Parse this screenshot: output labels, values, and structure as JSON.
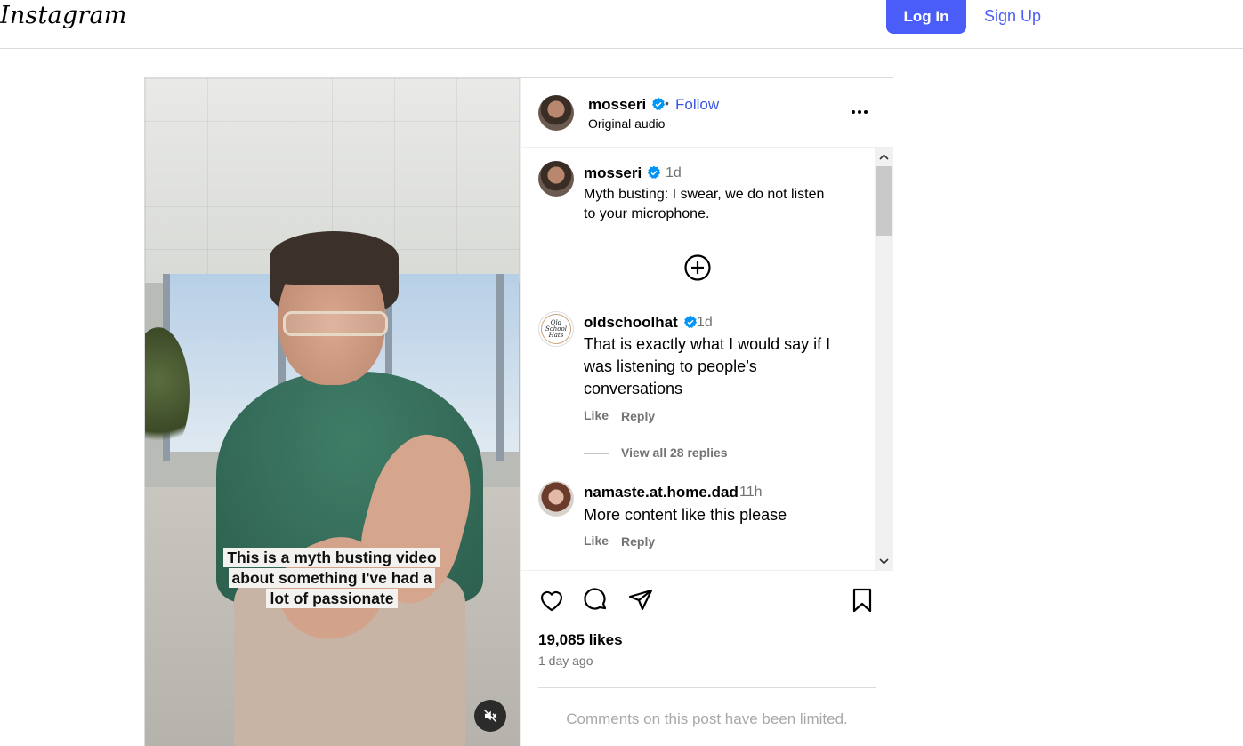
{
  "topbar": {
    "logo": "Instagram",
    "login_label": "Log In",
    "signup_label": "Sign Up"
  },
  "media": {
    "caption_lines": [
      "This is a myth busting video",
      "about something I've had a",
      "lot of passionate"
    ],
    "mute_icon": "muted-speaker-icon"
  },
  "post_header": {
    "username": "mosseri",
    "separator": "•",
    "follow_label": "Follow",
    "audio": "Original audio"
  },
  "caption_comment": {
    "username": "mosseri",
    "time": "1d",
    "text_lines": [
      "Myth busting: I swear, we do not listen",
      "to your microphone."
    ]
  },
  "comments": [
    {
      "username": "oldschoolhat",
      "avatar_text": "Old School Hats",
      "time": "1d",
      "text_lines": [
        "That is exactly what I would say if I",
        "was listening to people’s",
        "conversations"
      ],
      "like_label": "Like",
      "reply_label": "Reply",
      "view_replies": "View all 28 replies"
    },
    {
      "username": "namaste.at.home.dad",
      "time": "11h",
      "text": "More content like this please",
      "like_label": "Like",
      "reply_label": "Reply"
    }
  ],
  "actions": {
    "likes": "19,085 likes",
    "time_ago": "1 day ago",
    "limited_notice": "Comments on this post have been limited."
  },
  "colors": {
    "brand_blue": "#4a5df9",
    "verified_blue": "#0095f6",
    "muted_text": "#737373",
    "border": "#dbdbdb"
  }
}
